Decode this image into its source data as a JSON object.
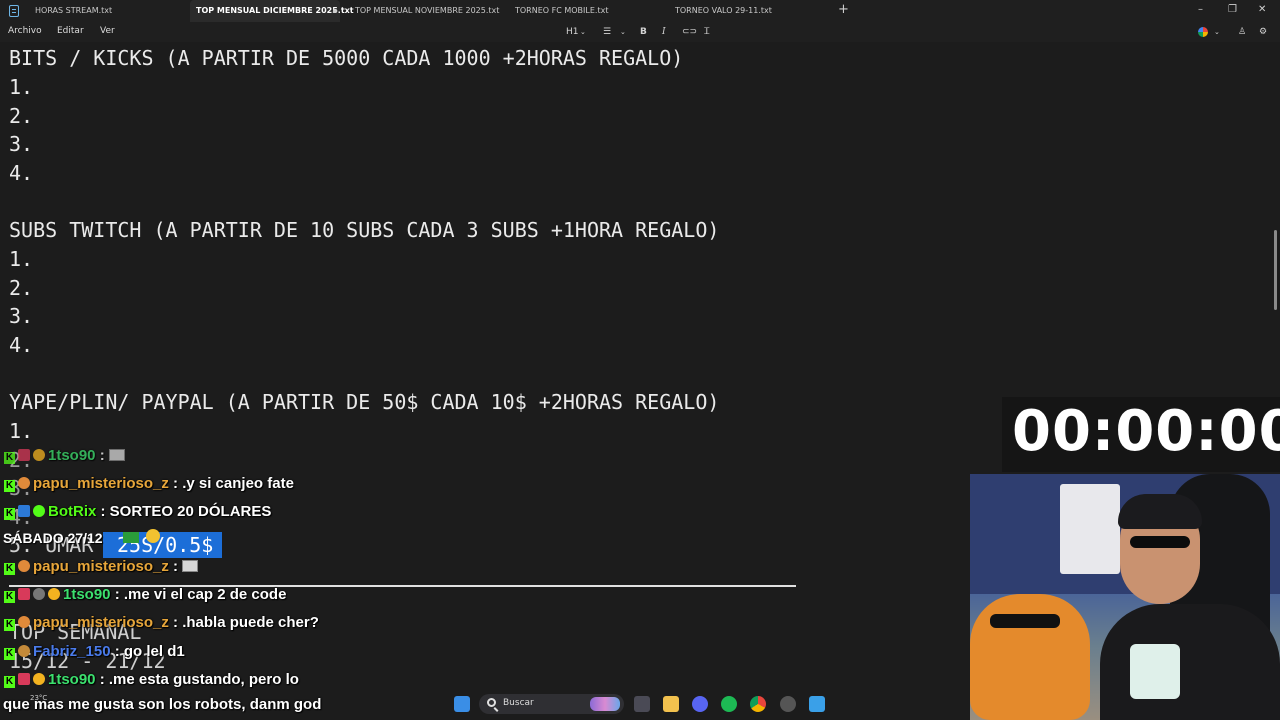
{
  "tabs": [
    {
      "label": "HORAS STREAM.txt"
    },
    {
      "label": "TOP MENSUAL DICIEMBRE 2025.txt"
    },
    {
      "label": "TOP MENSUAL NOVIEMBRE 2025.txt"
    },
    {
      "label": "TORNEO FC MOBILE.txt"
    },
    {
      "label": "TORNEO VALO 29-11.txt"
    }
  ],
  "menu": {
    "file": "Archivo",
    "edit": "Editar",
    "view": "Ver"
  },
  "toolbar": {
    "heading": "H1",
    "bold": "B",
    "italic": "I"
  },
  "editor": {
    "lines": [
      "BITS / KICKS (A PARTIR DE 5000 CADA 1000 +2HORAS REGALO)",
      "1.",
      "2.",
      "3.",
      "4.",
      "SUBS TWITCH (A PARTIR DE 10 SUBS CADA 3 SUBS +1HORA REGALO)",
      "1.",
      "2.",
      "3.",
      "4.",
      "YAPE/PLIN/ PAYPAL (A PARTIR DE 50$ CADA 10$ +2HORAS REGALO)",
      "1.",
      "2.",
      "3.",
      "4.",
      "5. UMAR",
      "25S/0.5$",
      "TOP SEMANAL",
      "15/12 - 21/12"
    ]
  },
  "timer": "00:00:00",
  "overlay": {
    "date_label": "SÁBADO 27/12"
  },
  "chat": [
    {
      "user": "1tso90",
      "message": " :"
    },
    {
      "user": "papu_misterioso_z",
      "message": " : .y si canjeo fate"
    },
    {
      "user": "BotRix",
      "message": " : SORTEO 20 DÓLARES"
    },
    {
      "user": "papu_misterioso_z",
      "message": " :"
    },
    {
      "user": "1tso90",
      "message": " : .me vi el cap 2 de code"
    },
    {
      "user": "papu_misterioso_z",
      "message": " : .habla puede cher?"
    },
    {
      "user": "Fabriz_150",
      "message": " : go lel d1"
    },
    {
      "user": "1tso90",
      "message": " : .me esta gustando, pero lo"
    },
    {
      "user": "",
      "message": "que mas me gusta son los robots, danm god"
    }
  ],
  "taskbar": {
    "search": "Buscar",
    "weather": "23°C"
  },
  "colors": {
    "kick_green": "#53fc18",
    "selection": "#1c6ed8",
    "editor_bg": "#1c1c1c"
  }
}
